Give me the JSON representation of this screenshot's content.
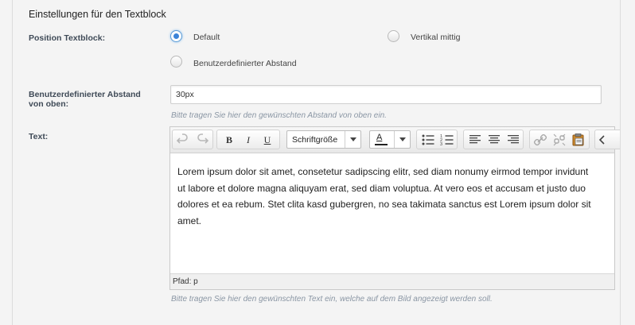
{
  "section": {
    "title": "Einstellungen für den Textblock"
  },
  "position": {
    "label": "Position Textblock:",
    "options": [
      {
        "label": "Default",
        "checked": true
      },
      {
        "label": "Vertikal mittig",
        "checked": false
      },
      {
        "label": "Benutzerdefinierter Abstand",
        "checked": false
      }
    ]
  },
  "offset": {
    "label_line1": "Benutzerdefinierter Abstand",
    "label_line2": "von oben:",
    "value": "30px",
    "hint": "Bitte tragen Sie hier den gewünschten Abstand von oben ein."
  },
  "text": {
    "label": "Text:",
    "toolbar": {
      "bold": "B",
      "italic": "I",
      "underline": "U",
      "font_size": "Schriftgröße",
      "font_color": "A"
    },
    "content_lines": [
      "Lorem ipsum dolor sit amet, consetetur sadipscing elitr, sed diam nonumy eirmod tempor invidunt",
      "ut labore et dolore magna aliquyam erat, sed diam voluptua. At vero eos et accusam et justo duo",
      "dolores et ea rebum. Stet clita kasd gubergren, no sea takimata sanctus est Lorem ipsum dolor sit",
      "amet."
    ],
    "path": "Pfad: p",
    "hint": "Bitte tragen Sie hier den gewünschten Text ein, welche auf dem Bild angezeigt werden soll."
  },
  "colors": {
    "accent": "#3b83d8",
    "hint": "#8a96a4",
    "label": "#3f4a57"
  },
  "icons": [
    "undo-icon",
    "redo-icon",
    "bullet-list-icon",
    "numbered-list-icon",
    "align-left-icon",
    "align-center-icon",
    "align-right-icon",
    "link-icon",
    "unlink-icon",
    "paste-icon",
    "source-code-icon"
  ]
}
